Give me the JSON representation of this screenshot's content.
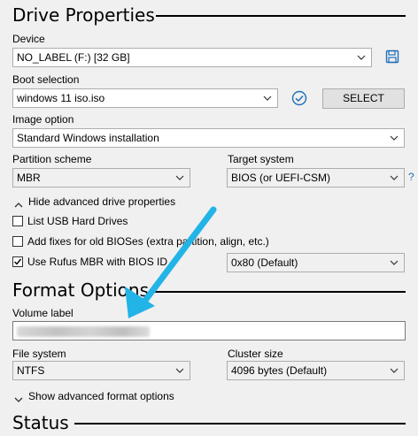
{
  "drive_properties": {
    "title": "Drive Properties",
    "device_label": "Device",
    "device_value": "NO_LABEL (F:) [32 GB]",
    "boot_selection_label": "Boot selection",
    "boot_selection_value": "windows 11 iso.iso",
    "select_button": "SELECT",
    "image_option_label": "Image option",
    "image_option_value": "Standard Windows installation",
    "partition_scheme_label": "Partition scheme",
    "partition_scheme_value": "MBR",
    "target_system_label": "Target system",
    "target_system_value": "BIOS (or UEFI-CSM)",
    "help_mark": "?",
    "advanced_toggle": "Hide advanced drive properties",
    "list_usb_label": "List USB Hard Drives",
    "list_usb_checked": false,
    "fixes_label": "Add fixes for old BIOSes (extra partition, align, etc.)",
    "fixes_checked": false,
    "rufus_mbr_label": "Use Rufus MBR with BIOS ID",
    "rufus_mbr_checked": true,
    "bios_id_value": "0x80 (Default)"
  },
  "format_options": {
    "title": "Format Options",
    "volume_label_label": "Volume label",
    "file_system_label": "File system",
    "file_system_value": "NTFS",
    "cluster_size_label": "Cluster size",
    "cluster_size_value": "4096 bytes (Default)",
    "advanced_toggle": "Show advanced format options"
  },
  "status": {
    "title": "Status"
  },
  "icons": {
    "save": "save-icon",
    "check": "check-circle-icon",
    "annotation_arrow": "annotation-arrow",
    "accent_color": "#1e9bd7",
    "arrow_color": "#22b4e6"
  }
}
